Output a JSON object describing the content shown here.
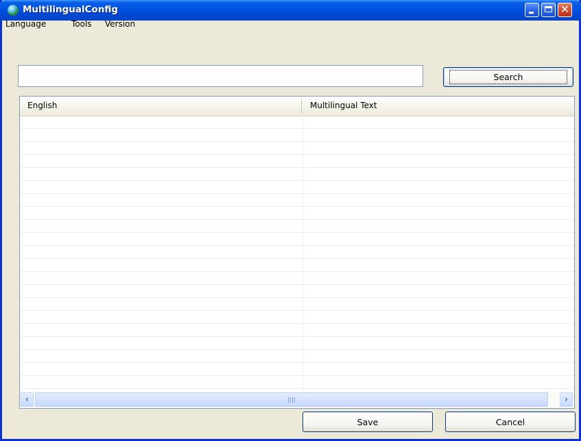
{
  "window": {
    "title": "MultilingualConfig",
    "close_glyph": "✕"
  },
  "menu": {
    "items": [
      "Language",
      "Tools",
      "Version"
    ]
  },
  "search": {
    "value": "",
    "placeholder": "",
    "button_label": "Search"
  },
  "table": {
    "columns": [
      "English",
      "Multilingual Text"
    ],
    "rows": [],
    "empty_row_count": 21
  },
  "scrollbar": {
    "left_arrow": "‹",
    "right_arrow": "›"
  },
  "footer": {
    "save_label": "Save",
    "cancel_label": "Cancel"
  },
  "colors": {
    "titlebar": "#0054e3",
    "window_bg": "#ece9d8",
    "border": "#0831d9"
  }
}
